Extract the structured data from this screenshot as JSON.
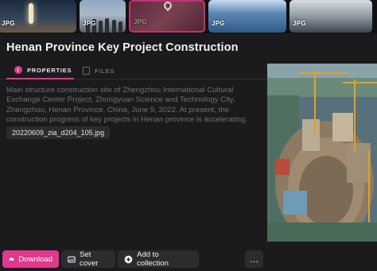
{
  "filmstrip": {
    "items": [
      {
        "badge": "JPG"
      },
      {
        "badge": "JPG"
      },
      {
        "badge": "JPG"
      },
      {
        "badge": "JPG"
      },
      {
        "badge": "JPG"
      }
    ]
  },
  "asset": {
    "title": "Henan Province Key Project Construction",
    "description": "Main structure construction site of Zhengzhou International Cultural Exchange Center Project, Zhongyuan Science and Technology City, Zhengzhou, Henan Province, China, June 9, 2022. At present, the construction progress of key projects in Henan province is accelerating.",
    "filename": "20220609_zia_d204_105.jpg"
  },
  "tabs": {
    "properties": "PROPERTIES",
    "files": "FILES",
    "active": "properties"
  },
  "actions": {
    "download": "Download",
    "set_cover": "Set cover",
    "add_to_collection": "Add to collection",
    "more": "…"
  },
  "colors": {
    "accent": "#e0388c",
    "background": "#1b1b1d",
    "button": "#2c2c2f",
    "muted_text": "#707074"
  },
  "icons": [
    "info-icon",
    "file-icon",
    "cloud-download-icon",
    "image-cover-icon",
    "plus-circle-icon",
    "more-icon",
    "map-pin-icon"
  ]
}
